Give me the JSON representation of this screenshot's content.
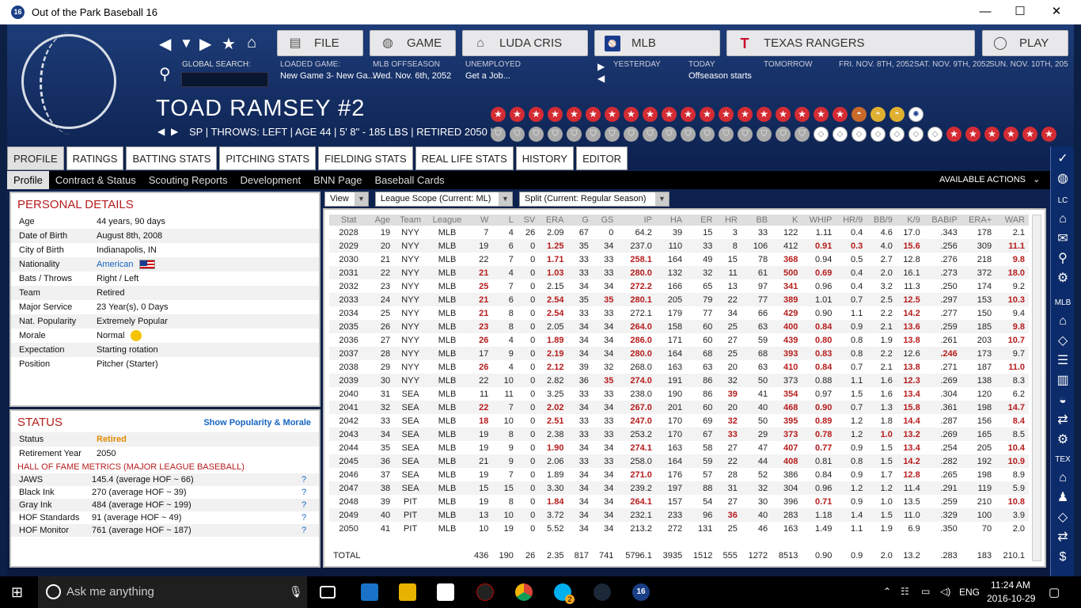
{
  "window": {
    "title": "Out of the Park Baseball 16",
    "app_icon_text": "16",
    "minimize": "—",
    "maximize": "☐",
    "close": "✕"
  },
  "topnav": {
    "buttons": [
      {
        "label": "FILE",
        "icon": "file-icon"
      },
      {
        "label": "GAME",
        "icon": "globe-icon"
      },
      {
        "label": "LUDA CRIS",
        "icon": "home-icon"
      },
      {
        "label": "MLB",
        "icon": "mlb-logo-icon"
      },
      {
        "label": "TEXAS RANGERS",
        "icon": "rangers-logo-icon"
      },
      {
        "label": "PLAY",
        "icon": "baseball-icon"
      }
    ],
    "global_search_label": "GLOBAL SEARCH:",
    "loaded_game_label": "LOADED GAME:",
    "loaded_game_value": "New Game 3- New Ga...",
    "mlb_offseason_label": "MLB OFFSEASON",
    "mlb_offseason_value": "Wed. Nov. 6th, 2052",
    "unemployed_label": "UNEMPLOYED",
    "unemployed_value": "Get a Job...",
    "yesterday": "YESTERDAY",
    "today": "TODAY",
    "today_value": "Offseason starts",
    "tomorrow": "TOMORROW",
    "day1": "FRI. NOV. 8TH, 2052",
    "day2": "SAT. NOV. 9TH, 2052",
    "day3": "SUN. NOV. 10TH, 205"
  },
  "player": {
    "name": "TOAD RAMSEY  #2",
    "line": "SP | THROWS: LEFT  |  AGE 44  |  5' 8\" - 185 LBS  |  RETIRED 2050  |"
  },
  "tabs": [
    "PROFILE",
    "RATINGS",
    "BATTING STATS",
    "PITCHING STATS",
    "FIELDING STATS",
    "REAL LIFE STATS",
    "HISTORY",
    "EDITOR"
  ],
  "subtabs": [
    "Profile",
    "Contract & Status",
    "Scouting Reports",
    "Development",
    "BNN Page",
    "Baseball Cards"
  ],
  "available_actions": "AVAILABLE ACTIONS",
  "sidebar": {
    "lc": "LC",
    "mlb": "MLB",
    "tex": "TEX"
  },
  "personal": {
    "title": "PERSONAL DETAILS",
    "rows": [
      {
        "k": "Age",
        "v": "44 years, 90 days"
      },
      {
        "k": "Date of Birth",
        "v": "August 8th, 2008"
      },
      {
        "k": "City of Birth",
        "v": "Indianapolis, IN"
      },
      {
        "k": "Nationality",
        "v": "American"
      },
      {
        "k": "Bats / Throws",
        "v": "Right / Left"
      },
      {
        "k": "Team",
        "v": "Retired"
      },
      {
        "k": "Major Service",
        "v": "23 Year(s), 0 Days"
      },
      {
        "k": "Nat. Popularity",
        "v": "Extremely Popular"
      },
      {
        "k": "Morale",
        "v": "Normal"
      },
      {
        "k": "Expectation",
        "v": "Starting rotation"
      },
      {
        "k": "Position",
        "v": "Pitcher (Starter)"
      }
    ]
  },
  "status": {
    "title": "STATUS",
    "link": "Show Popularity & Morale",
    "status_k": "Status",
    "status_v": "Retired",
    "retire_k": "Retirement Year",
    "retire_v": "2050",
    "hof_title": "HALL OF FAME METRICS (MAJOR LEAGUE BASEBALL)",
    "hof": [
      {
        "k": "JAWS",
        "v": "145.4 (average HOF ~ 66)"
      },
      {
        "k": "Black Ink",
        "v": "270 (average HOF ~ 39)"
      },
      {
        "k": "Gray Ink",
        "v": "484 (average HOF ~ 199)"
      },
      {
        "k": "HOF Standards",
        "v": "91 (average HOF ~ 49)"
      },
      {
        "k": "HOF Monitor",
        "v": "761 (average HOF ~ 187)"
      }
    ],
    "q": "?"
  },
  "controls": {
    "view": "View",
    "scope": "League Scope  (Current: ML)",
    "split": "Split  (Current: Regular Season)",
    "dd": "▼"
  },
  "stats": {
    "headers": [
      "Stat",
      "Age",
      "Team",
      "League",
      "W",
      "L",
      "SV",
      "ERA",
      "G",
      "GS",
      "IP",
      "HA",
      "ER",
      "HR",
      "BB",
      "K",
      "WHIP",
      "HR/9",
      "BB/9",
      "K/9",
      "BABIP",
      "ERA+",
      "WAR"
    ],
    "rows": [
      [
        "2028",
        "19",
        "NYY",
        "MLB",
        "7",
        "4",
        "26",
        "2.09",
        "67",
        "0",
        "64.2",
        "39",
        "15",
        "3",
        "33",
        "122",
        "1.11",
        "0.4",
        "4.6",
        "17.0",
        ".343",
        "178",
        "2.1"
      ],
      [
        "2029",
        "20",
        "NYY",
        "MLB",
        "19",
        "6",
        "0",
        "1.25",
        "35",
        "34",
        "237.0",
        "110",
        "33",
        "8",
        "106",
        "412",
        "0.91",
        "0.3",
        "4.0",
        "15.6",
        ".256",
        "309",
        "11.1"
      ],
      [
        "2030",
        "21",
        "NYY",
        "MLB",
        "22",
        "7",
        "0",
        "1.71",
        "33",
        "33",
        "258.1",
        "164",
        "49",
        "15",
        "78",
        "368",
        "0.94",
        "0.5",
        "2.7",
        "12.8",
        ".276",
        "218",
        "9.8"
      ],
      [
        "2031",
        "22",
        "NYY",
        "MLB",
        "21",
        "4",
        "0",
        "1.03",
        "33",
        "33",
        "280.0",
        "132",
        "32",
        "11",
        "61",
        "500",
        "0.69",
        "0.4",
        "2.0",
        "16.1",
        ".273",
        "372",
        "18.0"
      ],
      [
        "2032",
        "23",
        "NYY",
        "MLB",
        "25",
        "7",
        "0",
        "2.15",
        "34",
        "34",
        "272.2",
        "166",
        "65",
        "13",
        "97",
        "341",
        "0.96",
        "0.4",
        "3.2",
        "11.3",
        ".250",
        "174",
        "9.2"
      ],
      [
        "2033",
        "24",
        "NYY",
        "MLB",
        "21",
        "6",
        "0",
        "2.54",
        "35",
        "35",
        "280.1",
        "205",
        "79",
        "22",
        "77",
        "389",
        "1.01",
        "0.7",
        "2.5",
        "12.5",
        ".297",
        "153",
        "10.3"
      ],
      [
        "2034",
        "25",
        "NYY",
        "MLB",
        "21",
        "8",
        "0",
        "2.54",
        "33",
        "33",
        "272.1",
        "179",
        "77",
        "34",
        "66",
        "429",
        "0.90",
        "1.1",
        "2.2",
        "14.2",
        ".277",
        "150",
        "9.4"
      ],
      [
        "2035",
        "26",
        "NYY",
        "MLB",
        "23",
        "8",
        "0",
        "2.05",
        "34",
        "34",
        "264.0",
        "158",
        "60",
        "25",
        "63",
        "400",
        "0.84",
        "0.9",
        "2.1",
        "13.6",
        ".259",
        "185",
        "9.8"
      ],
      [
        "2036",
        "27",
        "NYY",
        "MLB",
        "26",
        "4",
        "0",
        "1.89",
        "34",
        "34",
        "286.0",
        "171",
        "60",
        "27",
        "59",
        "439",
        "0.80",
        "0.8",
        "1.9",
        "13.8",
        ".261",
        "203",
        "10.7"
      ],
      [
        "2037",
        "28",
        "NYY",
        "MLB",
        "17",
        "9",
        "0",
        "2.19",
        "34",
        "34",
        "280.0",
        "164",
        "68",
        "25",
        "68",
        "393",
        "0.83",
        "0.8",
        "2.2",
        "12.6",
        ".246",
        "173",
        "9.7"
      ],
      [
        "2038",
        "29",
        "NYY",
        "MLB",
        "26",
        "4",
        "0",
        "2.12",
        "39",
        "32",
        "268.0",
        "163",
        "63",
        "20",
        "63",
        "410",
        "0.84",
        "0.7",
        "2.1",
        "13.8",
        ".271",
        "187",
        "11.0"
      ],
      [
        "2039",
        "30",
        "NYY",
        "MLB",
        "22",
        "10",
        "0",
        "2.82",
        "36",
        "35",
        "274.0",
        "191",
        "86",
        "32",
        "50",
        "373",
        "0.88",
        "1.1",
        "1.6",
        "12.3",
        ".269",
        "138",
        "8.3"
      ],
      [
        "2040",
        "31",
        "SEA",
        "MLB",
        "11",
        "11",
        "0",
        "3.25",
        "33",
        "33",
        "238.0",
        "190",
        "86",
        "39",
        "41",
        "354",
        "0.97",
        "1.5",
        "1.6",
        "13.4",
        ".304",
        "120",
        "6.2"
      ],
      [
        "2041",
        "32",
        "SEA",
        "MLB",
        "22",
        "7",
        "0",
        "2.02",
        "34",
        "34",
        "267.0",
        "201",
        "60",
        "20",
        "40",
        "468",
        "0.90",
        "0.7",
        "1.3",
        "15.8",
        ".361",
        "198",
        "14.7"
      ],
      [
        "2042",
        "33",
        "SEA",
        "MLB",
        "18",
        "10",
        "0",
        "2.51",
        "33",
        "33",
        "247.0",
        "170",
        "69",
        "32",
        "50",
        "395",
        "0.89",
        "1.2",
        "1.8",
        "14.4",
        ".287",
        "156",
        "8.4"
      ],
      [
        "2043",
        "34",
        "SEA",
        "MLB",
        "19",
        "8",
        "0",
        "2.38",
        "33",
        "33",
        "253.2",
        "170",
        "67",
        "33",
        "29",
        "373",
        "0.78",
        "1.2",
        "1.0",
        "13.2",
        ".269",
        "165",
        "8.5"
      ],
      [
        "2044",
        "35",
        "SEA",
        "MLB",
        "19",
        "9",
        "0",
        "1.90",
        "34",
        "34",
        "274.1",
        "163",
        "58",
        "27",
        "47",
        "407",
        "0.77",
        "0.9",
        "1.5",
        "13.4",
        ".254",
        "205",
        "10.4"
      ],
      [
        "2045",
        "36",
        "SEA",
        "MLB",
        "21",
        "9",
        "0",
        "2.06",
        "33",
        "33",
        "258.0",
        "164",
        "59",
        "22",
        "44",
        "408",
        "0.81",
        "0.8",
        "1.5",
        "14.2",
        ".282",
        "192",
        "10.9"
      ],
      [
        "2046",
        "37",
        "SEA",
        "MLB",
        "19",
        "7",
        "0",
        "1.89",
        "34",
        "34",
        "271.0",
        "176",
        "57",
        "28",
        "52",
        "386",
        "0.84",
        "0.9",
        "1.7",
        "12.8",
        ".265",
        "198",
        "8.9"
      ],
      [
        "2047",
        "38",
        "SEA",
        "MLB",
        "15",
        "15",
        "0",
        "3.30",
        "34",
        "34",
        "239.2",
        "197",
        "88",
        "31",
        "32",
        "304",
        "0.96",
        "1.2",
        "1.2",
        "11.4",
        ".291",
        "119",
        "5.9"
      ],
      [
        "2048",
        "39",
        "PIT",
        "MLB",
        "19",
        "8",
        "0",
        "1.84",
        "34",
        "34",
        "264.1",
        "157",
        "54",
        "27",
        "30",
        "396",
        "0.71",
        "0.9",
        "1.0",
        "13.5",
        ".259",
        "210",
        "10.8"
      ],
      [
        "2049",
        "40",
        "PIT",
        "MLB",
        "13",
        "10",
        "0",
        "3.72",
        "34",
        "34",
        "232.1",
        "233",
        "96",
        "36",
        "40",
        "283",
        "1.18",
        "1.4",
        "1.5",
        "11.0",
        ".329",
        "100",
        "3.9"
      ],
      [
        "2050",
        "41",
        "PIT",
        "MLB",
        "10",
        "19",
        "0",
        "5.52",
        "34",
        "34",
        "213.2",
        "272",
        "131",
        "25",
        "46",
        "163",
        "1.49",
        "1.1",
        "1.9",
        "6.9",
        ".350",
        "70",
        "2.0"
      ]
    ],
    "highlight": [
      [],
      [
        7,
        16,
        17,
        19,
        22
      ],
      [
        7,
        10,
        15,
        22
      ],
      [
        4,
        7,
        10,
        15,
        16,
        22
      ],
      [
        4,
        10,
        15
      ],
      [
        4,
        7,
        9,
        10,
        15,
        19,
        22
      ],
      [
        4,
        7,
        15,
        19
      ],
      [
        4,
        10,
        15,
        16,
        19,
        22
      ],
      [
        4,
        7,
        10,
        15,
        16,
        19,
        22
      ],
      [
        7,
        10,
        15,
        16,
        20
      ],
      [
        4,
        7,
        15,
        16,
        19,
        22
      ],
      [
        9,
        10,
        19
      ],
      [
        13,
        15,
        19
      ],
      [
        4,
        7,
        10,
        15,
        16,
        19,
        22
      ],
      [
        4,
        7,
        10,
        13,
        15,
        16,
        19,
        22
      ],
      [
        13,
        15,
        16,
        18,
        19
      ],
      [
        7,
        10,
        15,
        16,
        19,
        22
      ],
      [
        15,
        19,
        22
      ],
      [
        10,
        19
      ],
      [],
      [
        7,
        10,
        16,
        22
      ],
      [
        13
      ],
      []
    ],
    "total": [
      "TOTAL",
      "",
      "",
      "",
      "436",
      "190",
      "26",
      "2.35",
      "817",
      "741",
      "5796.1",
      "3935",
      "1512",
      "555",
      "1272",
      "8513",
      "0.90",
      "0.9",
      "2.0",
      "13.2",
      ".283",
      "183",
      "210.1"
    ]
  },
  "taskbar": {
    "search": "Ask me anything",
    "lang": "ENG",
    "time": "11:24 AM",
    "date": "2016-10-29",
    "badge": "2",
    "ootp": "16"
  }
}
